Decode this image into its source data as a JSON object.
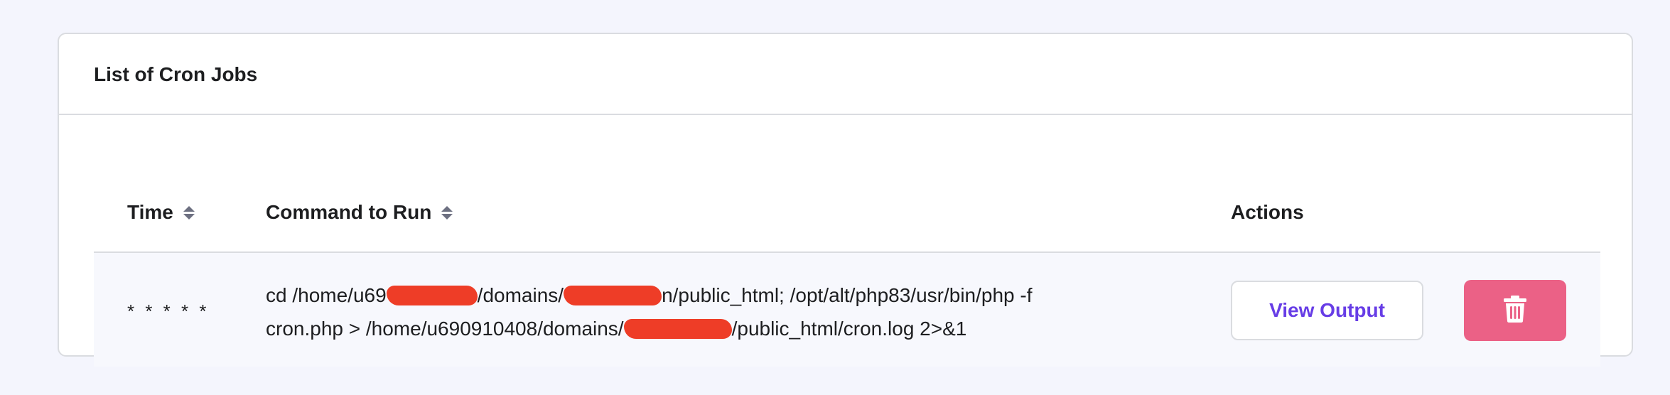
{
  "card": {
    "title": "List of Cron Jobs"
  },
  "table": {
    "columns": {
      "time": "Time",
      "command": "Command to Run",
      "actions": "Actions"
    },
    "rows": [
      {
        "time": "* * * * *",
        "command_line1_a": "cd /home/u69",
        "command_line1_b": "/domains/",
        "command_line1_c": "n/public_html; /opt/alt/php83/usr/bin/php -f",
        "command_line2_a": "cron.php > /home/u690910408/domains/",
        "command_line2_b": "/public_html/cron.log 2>&1"
      }
    ]
  },
  "actions": {
    "view_output_label": "View Output",
    "delete_icon": "trash-icon"
  },
  "colors": {
    "accent": "#673de6",
    "danger": "#eb6186",
    "redaction": "#ee3d27"
  }
}
